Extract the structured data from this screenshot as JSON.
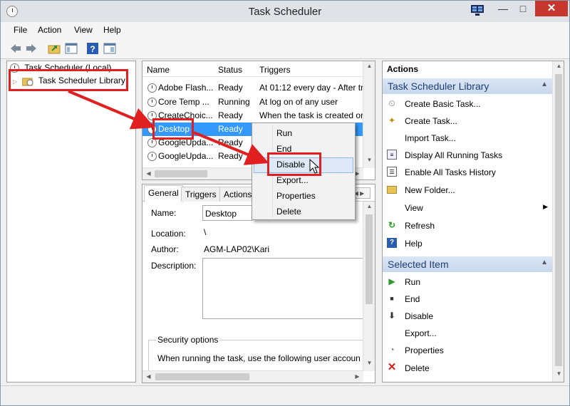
{
  "window": {
    "title": "Task Scheduler",
    "minimize": "—",
    "maximize": "□",
    "close": "✕"
  },
  "menu": [
    "File",
    "Action",
    "View",
    "Help"
  ],
  "tree": {
    "root": "Task Scheduler (Local)",
    "child": "Task Scheduler Library"
  },
  "tasks": {
    "columns": [
      "Name",
      "Status",
      "Triggers"
    ],
    "rows": [
      {
        "name": "Adobe Flash...",
        "status": "Ready",
        "trigger": "At 01:12 every day - After tri"
      },
      {
        "name": "Core Temp ...",
        "status": "Running",
        "trigger": "At log on of any user"
      },
      {
        "name": "CreateChoic...",
        "status": "Ready",
        "trigger": "When the task is created or"
      },
      {
        "name": "Desktop",
        "status": "Ready",
        "trigger": ""
      },
      {
        "name": "GoogleUpda...",
        "status": "Ready",
        "trigger": ""
      },
      {
        "name": "GoogleUpda...",
        "status": "Ready",
        "trigger": ""
      }
    ],
    "selected_index": 3
  },
  "context_menu": {
    "items": [
      "Run",
      "End",
      "Disable",
      "Export...",
      "Properties",
      "Delete"
    ],
    "hover_index": 2
  },
  "detail": {
    "tabs": [
      "General",
      "Triggers",
      "Actions"
    ],
    "name_label": "Name:",
    "name_value": "Desktop",
    "location_label": "Location:",
    "location_value": "\\",
    "author_label": "Author:",
    "author_value": "AGM-LAP02\\Kari",
    "description_label": "Description:",
    "security_label": "Security options",
    "security_text": "When running the task, use the following user accoun"
  },
  "actions": {
    "header": "Actions",
    "library_section": "Task Scheduler Library",
    "library_items": [
      {
        "label": "Create Basic Task...",
        "icon": "create-basic-task-icon"
      },
      {
        "label": "Create Task...",
        "icon": "create-task-icon"
      },
      {
        "label": "Import Task...",
        "icon": ""
      },
      {
        "label": "Display All Running Tasks",
        "icon": "running-tasks-icon"
      },
      {
        "label": "Enable All Tasks History",
        "icon": "history-icon"
      },
      {
        "label": "New Folder...",
        "icon": "folder-icon"
      },
      {
        "label": "View",
        "icon": ""
      },
      {
        "label": "Refresh",
        "icon": "refresh-icon"
      },
      {
        "label": "Help",
        "icon": "help-icon"
      }
    ],
    "selected_section": "Selected Item",
    "selected_items": [
      {
        "label": "Run",
        "icon": "run-icon"
      },
      {
        "label": "End",
        "icon": "end-icon"
      },
      {
        "label": "Disable",
        "icon": "disable-icon"
      },
      {
        "label": "Export...",
        "icon": ""
      },
      {
        "label": "Properties",
        "icon": "properties-icon"
      },
      {
        "label": "Delete",
        "icon": "delete-icon"
      }
    ]
  },
  "colors": {
    "selection": "#3399ff",
    "highlight": "#e02020",
    "section_text": "#1e3f75"
  }
}
